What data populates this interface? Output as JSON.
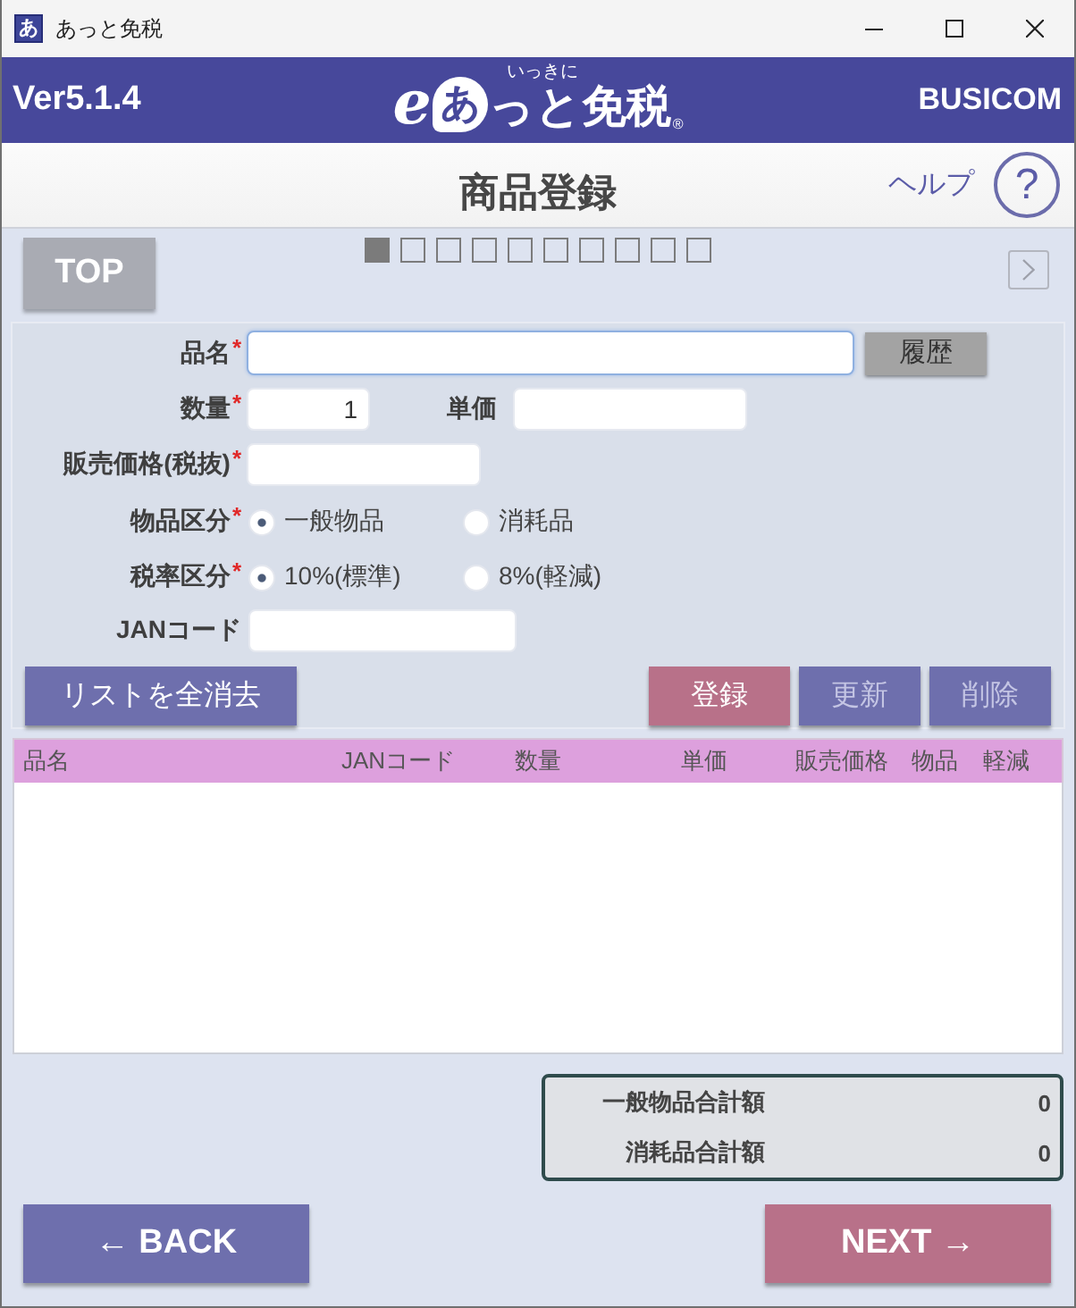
{
  "window": {
    "icon": "あ",
    "title": "あっと免税"
  },
  "header": {
    "version": "Ver5.1.4",
    "logo": {
      "letter": "e",
      "bubble": "あ",
      "ruby": "いっきに",
      "text": "っと免税",
      "mark": "®"
    },
    "company": "BUSICOM"
  },
  "page": {
    "title": "商品登録",
    "help_link": "ヘルプ",
    "help_button": "?"
  },
  "top_bar": {
    "top_button": "TOP",
    "steps": [
      {
        "selected": true
      },
      {
        "selected": false
      },
      {
        "selected": false
      },
      {
        "selected": false
      },
      {
        "selected": false
      },
      {
        "selected": false
      },
      {
        "selected": false
      },
      {
        "selected": false
      },
      {
        "selected": false
      },
      {
        "selected": false
      }
    ]
  },
  "form": {
    "product_name": {
      "label": "品名",
      "required_mark": "*",
      "focused": true
    },
    "history_button": "履歴",
    "quantity": {
      "label": "数量",
      "required_mark": "*",
      "value": "1"
    },
    "unit_price": {
      "label": "単価"
    },
    "sale_price": {
      "label": "販売価格(税抜)",
      "required_mark": "*"
    },
    "item_category": {
      "label": "物品区分",
      "required_mark": "*",
      "options": [
        {
          "label": "一般物品",
          "selected": true
        },
        {
          "label": "消耗品",
          "selected": false
        }
      ]
    },
    "tax_rate": {
      "label": "税率区分",
      "required_mark": "*",
      "options": [
        {
          "label": "10%(標準)",
          "selected": true
        },
        {
          "label": "8%(軽減)",
          "selected": false
        }
      ]
    },
    "jan_code": {
      "label": "JANコード"
    }
  },
  "list_buttons": [
    {
      "kind": "clear",
      "label": "リストを全消去",
      "disabled": false
    },
    {
      "kind": "register",
      "label": "登録",
      "disabled": false
    },
    {
      "kind": "update",
      "label": "更新",
      "disabled": true
    },
    {
      "kind": "delete",
      "label": "削除",
      "disabled": true
    }
  ],
  "table": {
    "columns": [
      "品名",
      "JANコード",
      "数量",
      "単価",
      "販売価格",
      "物品",
      "軽減"
    ]
  },
  "totals": [
    {
      "label": "一般物品合計額",
      "value": "0"
    },
    {
      "label": "消耗品合計額",
      "value": "0"
    }
  ],
  "navigation": [
    {
      "kind": "back",
      "label": "← BACK"
    },
    {
      "kind": "next",
      "label": "NEXT →"
    }
  ]
}
